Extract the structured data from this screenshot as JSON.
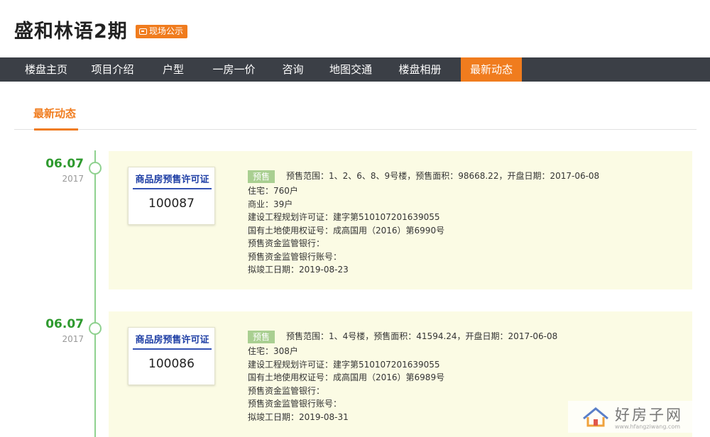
{
  "header": {
    "title": "盛和林语2期",
    "badge": "现场公示"
  },
  "nav": {
    "items": [
      {
        "label": "楼盘主页",
        "width": 130
      },
      {
        "label": "项目介绍",
        "width": 0
      },
      {
        "label": "户型"
      },
      {
        "label": "一房一价"
      },
      {
        "label": "咨询"
      },
      {
        "label": "地图交通"
      },
      {
        "label": "楼盘相册"
      },
      {
        "label": "最新动态"
      }
    ],
    "active": "最新动态"
  },
  "section": {
    "tab": "最新动态"
  },
  "entries": [
    {
      "date": "06.07",
      "year": "2017",
      "cert_title": "商品房预售许可证",
      "cert_no": "100087",
      "tag": "预售",
      "lines": [
        "预售范围：1、2、6、8、9号楼，预售面积：98668.22，开盘日期：2017-06-08",
        "住宅：760户",
        "商业：39户",
        "建设工程规划许可证：建字第510107201639055",
        "国有土地使用权证号：成高国用（2016）第6990号",
        "预售资金监管银行：",
        "预售资金监管银行账号：",
        "拟竣工日期：2019-08-23"
      ]
    },
    {
      "date": "06.07",
      "year": "2017",
      "cert_title": "商品房预售许可证",
      "cert_no": "100086",
      "tag": "预售",
      "lines": [
        "预售范围：1、4号楼，预售面积：41594.24，开盘日期：2017-06-08",
        "住宅：308户",
        "建设工程规划许可证：建字第510107201639055",
        "国有土地使用权证号：成高国用（2016）第6989号",
        "预售资金监管银行：",
        "预售资金监管银行账号：",
        "拟竣工日期：2019-08-31"
      ]
    }
  ],
  "watermark": {
    "text": "好房子网",
    "url": "www.hfangziwang.com"
  },
  "colors": {
    "accent": "#f07c1e",
    "nav_bg": "#3b3f46",
    "timeline_green": "#2e9a2e",
    "card_bg": "#fbfbe4",
    "tag_green": "#a9cf91",
    "cert_blue": "#1f3fa5"
  }
}
